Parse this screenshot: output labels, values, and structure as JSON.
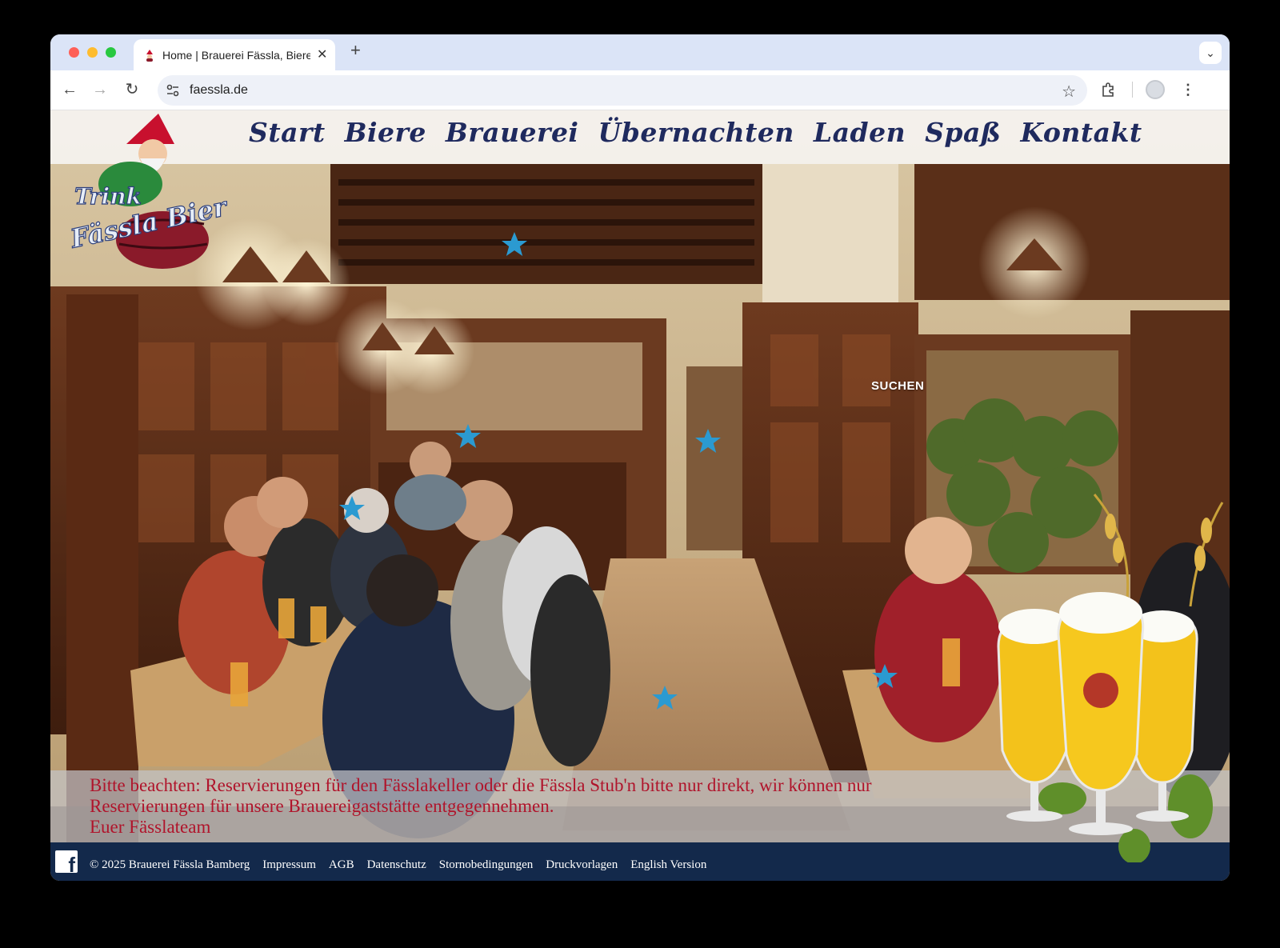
{
  "browser": {
    "tab_title": "Home | Brauerei Fässla, Biere",
    "new_tab_label": "+",
    "close_tab_label": "✕",
    "url": "faessla.de",
    "back_icon": "arrow-left-icon",
    "forward_icon": "arrow-right-icon",
    "reload_icon": "reload-icon"
  },
  "site": {
    "nav": [
      "Start",
      "Biere",
      "Brauerei",
      "Übernachten",
      "Laden",
      "Spaß",
      "Kontakt"
    ],
    "logo_text": [
      "Trink",
      "Fässla Bier"
    ],
    "search_label": "SUCHEN",
    "notice": {
      "line1": "Bitte beachten: Reservierungen für den Fässlakeller oder die Fässla Stub'n bitte nur direkt, wir können nur",
      "line2": "Reservierungen für unsere Brauereigaststätte entgegennehmen.",
      "line3": "Euer Fässlateam"
    },
    "footer": {
      "copyright": "© 2025 Brauerei Fässla Bamberg",
      "links": [
        "Impressum",
        "AGB",
        "Datenschutz",
        "Stornobedingungen",
        "Druckvorlagen",
        "English Version"
      ]
    },
    "colors": {
      "nav_text": "#1f2a5e",
      "notice_text": "#b0142b",
      "footer_bg": "#13294b",
      "star": "#2b9ad1"
    }
  }
}
